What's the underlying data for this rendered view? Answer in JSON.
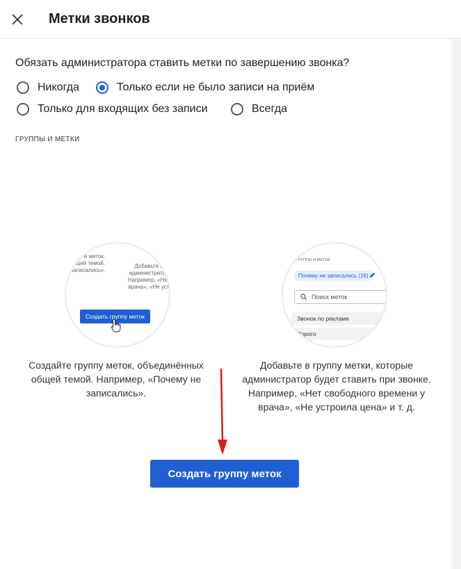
{
  "header": {
    "title": "Метки звонков",
    "close_icon": "close-icon"
  },
  "question": "Обязать администратора ставить метки по завершению звонка?",
  "radios": [
    {
      "label": "Никогда",
      "checked": false
    },
    {
      "label": "Только если не было записи на приём",
      "checked": true
    },
    {
      "label": "Только для входящих без записи",
      "checked": false
    },
    {
      "label": "Всегда",
      "checked": false
    }
  ],
  "section_label": "ГРУППЫ И МЕТКИ",
  "illustration_left": {
    "text_a": "й меток,\nщей темой.\nзаписались».",
    "text_b": "Добавьте в\nадминистратор\nНапример, «Нет\nврача», «Не уст",
    "button": "Создать группу меток"
  },
  "illustration_right": {
    "section": "ГРУППЫ И МЕТКИ",
    "chip": "Почему не записались (16)",
    "search": "Поиск меток",
    "row1": "Звонок по рекламе",
    "row2": "Дорого"
  },
  "desc_left": "Создайте группу меток, объединённых общей темой. Например, «Почему не записались».",
  "desc_right": "Добавьте в группу метки, которые администратор будет ставить при звонке. Например, «Нет свободного времени у врача», «Не устроила цена» и т. д.",
  "primary_button": "Создать группу меток",
  "colors": {
    "accent": "#1f5fd1",
    "arrow": "#e0191e"
  }
}
